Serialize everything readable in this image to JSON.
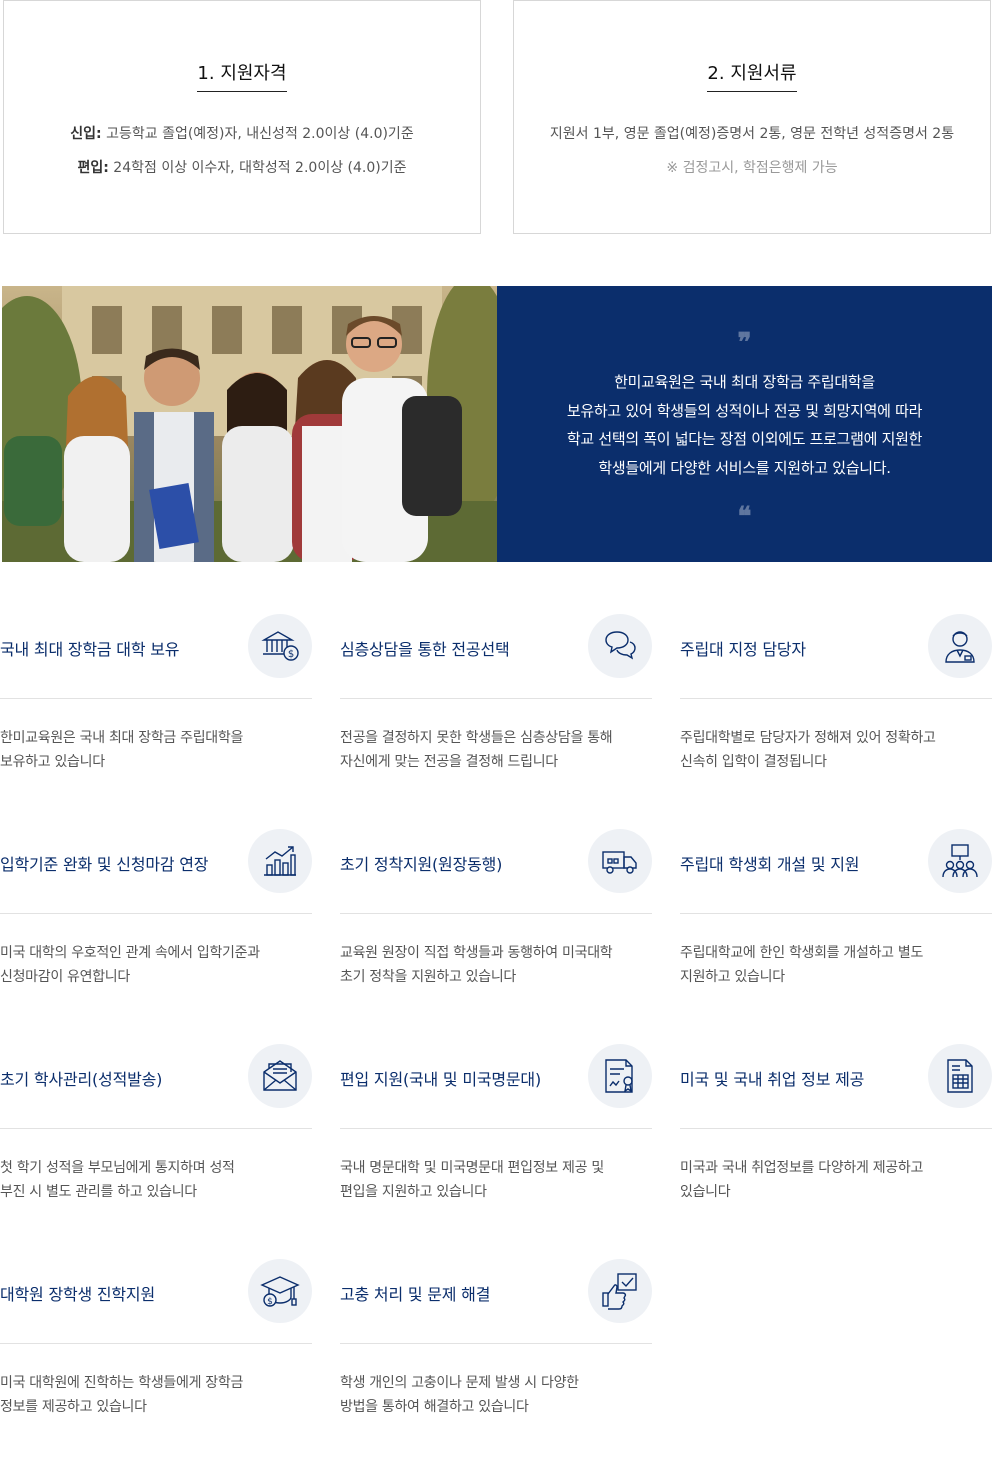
{
  "requirements": [
    {
      "title": "1. 지원자격",
      "lines": [
        {
          "label": "신입:",
          "text": " 고등학교 졸업(예정)자, 내신성적 2.0이상 (4.0)기준"
        },
        {
          "label": "편입:",
          "text": " 24학점 이상 이수자, 대학성적 2.0이상 (4.0)기준"
        }
      ]
    },
    {
      "title": "2. 지원서류",
      "line": "지원서 1부, 영문 졸업(예정)증명서 2통, 영문 전학년 성적증명서 2통",
      "note": "※ 검정고시, 학점은행제 가능"
    }
  ],
  "banner": {
    "quote_open": "❞",
    "quote_close": "❝",
    "lines": [
      "한미교육원은 국내 최대 장학금 주립대학을",
      "보유하고 있어 학생들의 성적이나 전공 및 희망지역에 따라",
      "학교 선택의 폭이 넓다는 장점 이외에도 프로그램에 지원한",
      "학생들에게 다양한 서비스를 지원하고 있습니다."
    ]
  },
  "features": [
    {
      "title": "국내 최대 장학금 대학 보유",
      "icon": "bank-money-icon",
      "desc": [
        "한미교육원은 국내 최대 장학금 주립대학을",
        "보유하고 있습니다"
      ]
    },
    {
      "title": "심층상담을 통한 전공선택",
      "icon": "chat-bubbles-icon",
      "desc": [
        "전공을 결정하지 못한 학생들은 심층상담을 통해",
        "자신에게 맞는 전공을 결정해 드립니다"
      ]
    },
    {
      "title": "주립대 지정 담당자",
      "icon": "person-icon",
      "desc": [
        "주립대학별로 담당자가 정해져 있어 정확하고",
        "신속히 입학이 결정됩니다"
      ]
    },
    {
      "title": "입학기준 완화 및 신청마감 연장",
      "icon": "bar-chart-up-icon",
      "desc": [
        "미국 대학의 우호적인 관계 속에서 입학기준과",
        "신청마감이 유연합니다"
      ]
    },
    {
      "title": "초기 정착지원(원장동행)",
      "icon": "truck-icon",
      "desc": [
        "교육원 원장이  직접 학생들과 동행하여 미국대학",
        "초기 정착을 지원하고 있습니다"
      ]
    },
    {
      "title": "주립대 학생회 개설 및 지원",
      "icon": "group-board-icon",
      "desc": [
        "주립대학교에 한인 학생회를 개설하고 별도",
        "지원하고 있습니다"
      ]
    },
    {
      "title": "초기 학사관리(성적발송)",
      "icon": "envelope-letter-icon",
      "desc": [
        "첫 학기 성적을 부모님에게 통지하며 성적",
        "부진 시 별도 관리를 하고 있습니다"
      ]
    },
    {
      "title": "편입 지원(국내 및 미국명문대)",
      "icon": "certificate-icon",
      "desc": [
        "국내 명문대학 및 미국명문대 편입정보 제공 및",
        "편입을 지원하고 있습니다"
      ]
    },
    {
      "title": "미국 및 국내 취업 정보 제공",
      "icon": "document-calculator-icon",
      "desc": [
        "미국과 국내 취업정보를  다양하게 제공하고",
        "있습니다"
      ]
    },
    {
      "title": "대학원 장학생 진학지원",
      "icon": "graduation-cap-icon",
      "desc": [
        "미국 대학원에 진학하는 학생들에게 장학금",
        "정보를 제공하고 있습니다"
      ]
    },
    {
      "title": "고충 처리 및 문제 해결",
      "icon": "thumbs-up-check-icon",
      "desc": [
        "학생 개인의 고충이나 문제 발생 시 다양한",
        "방법을 통하여 해결하고 있습니다"
      ]
    }
  ]
}
